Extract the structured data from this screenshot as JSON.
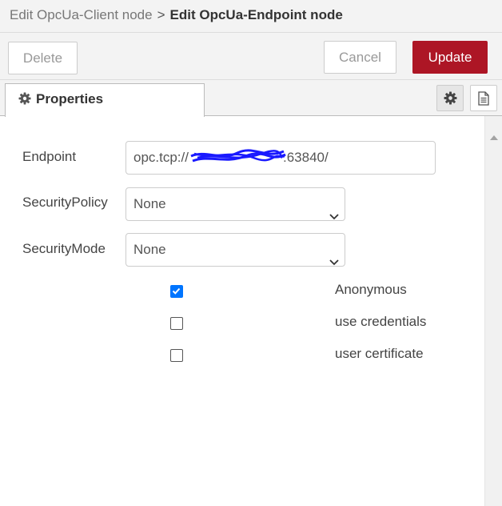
{
  "breadcrumb": {
    "parent": "Edit OpcUa-Client node",
    "separator": ">",
    "current": "Edit OpcUa-Endpoint node"
  },
  "toolbar": {
    "delete_label": "Delete",
    "cancel_label": "Cancel",
    "update_label": "Update"
  },
  "tabs": {
    "properties": {
      "label": "Properties",
      "icon": "cog-icon"
    },
    "side_buttons": [
      {
        "icon": "gear-icon",
        "active": true
      },
      {
        "icon": "document-icon",
        "active": false
      }
    ]
  },
  "form": {
    "endpoint": {
      "label": "Endpoint",
      "value_prefix": "opc.tcp://",
      "value_suffix": ":63840/",
      "redacted": true
    },
    "security_policy": {
      "label": "SecurityPolicy",
      "value": "None"
    },
    "security_mode": {
      "label": "SecurityMode",
      "value": "None"
    },
    "options": [
      {
        "label": "Anonymous",
        "checked": true
      },
      {
        "label": "use credentials",
        "checked": false
      },
      {
        "label": "user certificate",
        "checked": false
      }
    ]
  },
  "colors": {
    "accent": "#ad1625",
    "checkbox": "#0075ff",
    "redaction": "#1a1aff"
  }
}
